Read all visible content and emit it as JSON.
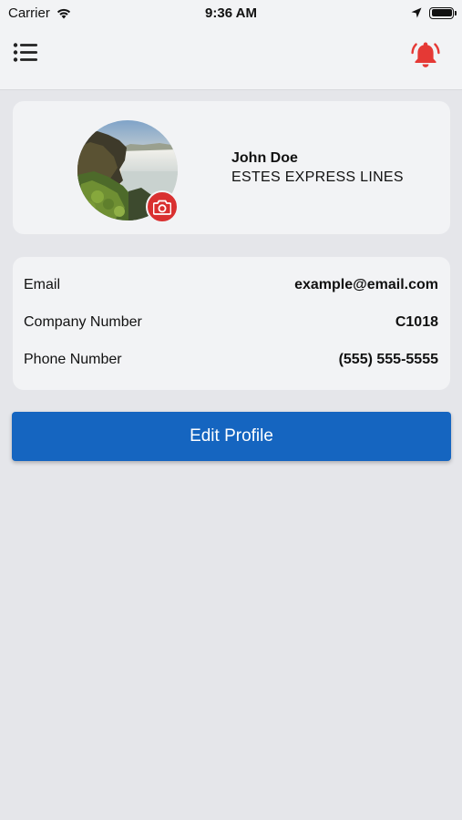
{
  "status_bar": {
    "carrier": "Carrier",
    "time": "9:36 AM"
  },
  "nav": {
    "menu_icon": "list-icon",
    "bell_icon": "bell-ringing-icon",
    "bell_color": "#e53935"
  },
  "profile": {
    "name": "John Doe",
    "company": "ESTES EXPRESS LINES",
    "camera_icon": "camera-icon",
    "camera_color": "#d93030"
  },
  "info": {
    "rows": [
      {
        "label": "Email",
        "value": "example@email.com"
      },
      {
        "label": "Company Number",
        "value": "C1018"
      },
      {
        "label": "Phone Number",
        "value": "(555) 555-5555"
      }
    ]
  },
  "actions": {
    "edit_profile_label": "Edit Profile",
    "edit_profile_color": "#1565c0"
  }
}
